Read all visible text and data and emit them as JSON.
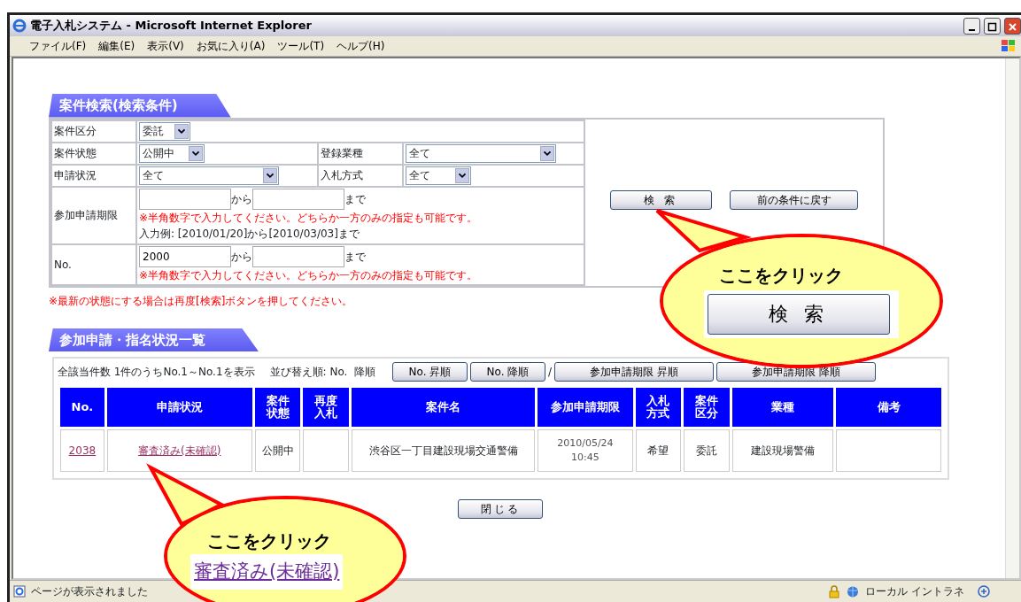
{
  "window": {
    "title": "電子入札システム - Microsoft Internet Explorer"
  },
  "menu": [
    "ファイル(F)",
    "編集(E)",
    "表示(V)",
    "お気に入り(A)",
    "ツール(T)",
    "ヘルプ(H)"
  ],
  "search": {
    "heading": "案件検索(検索条件)",
    "rows": [
      {
        "kind": "selects",
        "fields": [
          {
            "label": "案件区分",
            "value": "委託"
          }
        ]
      },
      {
        "kind": "selects",
        "fields": [
          {
            "label": "案件状態",
            "value": "公開中"
          },
          {
            "label": "登録業種",
            "value": "全て"
          }
        ]
      },
      {
        "kind": "selects",
        "fields": [
          {
            "label": "申請状況",
            "value": "全て"
          },
          {
            "label": "入札方式",
            "value": "全て"
          }
        ]
      },
      {
        "kind": "range",
        "label": "参加申請期限",
        "from": null,
        "from_word": "から",
        "to": null,
        "to_word": "まで",
        "note": "※半角数字で入力してください。どちらか一方のみの指定も可能です。",
        "example": "入力例: [2010/01/20]から[2010/03/03]まで"
      },
      {
        "kind": "range",
        "label": "No.",
        "from": "2000",
        "from_word": "から",
        "to": null,
        "to_word": "まで",
        "note": "※半角数字で入力してください。どちらか一方のみの指定も可能です。"
      }
    ],
    "buttons": [
      "検 索",
      "前の条件に戻す"
    ],
    "note": "※最新の状態にする場合は再度[検索]ボタンを押してください。"
  },
  "list": {
    "heading": "参加申請・指名状況一覧",
    "summary": "全該当件数 1件のうちNo.1～No.1を表示",
    "sort_label": "並び替え順: No.  降順",
    "sort_items": [
      {
        "kind": "button",
        "label": "No. 昇順"
      },
      {
        "kind": "button",
        "label": "No. 降順"
      },
      {
        "kind": "separator",
        "label": "/"
      },
      {
        "kind": "button",
        "label": "参加申請期限 昇順"
      },
      {
        "kind": "button",
        "label": "参加申請期限 降順"
      }
    ],
    "columns": [
      "No.",
      "申請状況",
      "案件状態",
      "再度入札",
      "案件名",
      "参加申請期限",
      "入札方式",
      "案件区分",
      "業種",
      "備考"
    ],
    "rows": [
      {
        "cells": [
          {
            "kind": "link",
            "text": "2038"
          },
          {
            "kind": "link",
            "text": "審査済み(未確認)"
          },
          {
            "kind": "text",
            "text": "公開中"
          },
          null,
          {
            "kind": "text",
            "text": "渋谷区一丁目建設現場交通警備"
          },
          {
            "kind": "lines",
            "lines": [
              "2010/05/24",
              "10:45"
            ]
          },
          {
            "kind": "text",
            "text": "希望"
          },
          {
            "kind": "text",
            "text": "委託"
          },
          {
            "kind": "text",
            "text": "建設現場警備"
          },
          null
        ]
      }
    ]
  },
  "close_button": "閉じる",
  "callouts": [
    {
      "kind": "button",
      "text": "ここをクリック",
      "example": "検 索"
    },
    {
      "kind": "link",
      "text": "ここをクリック",
      "example": "審査済み(未確認)"
    }
  ],
  "status_bar": {
    "text": "ページが表示されました",
    "zone": "ローカル イントラネ"
  }
}
